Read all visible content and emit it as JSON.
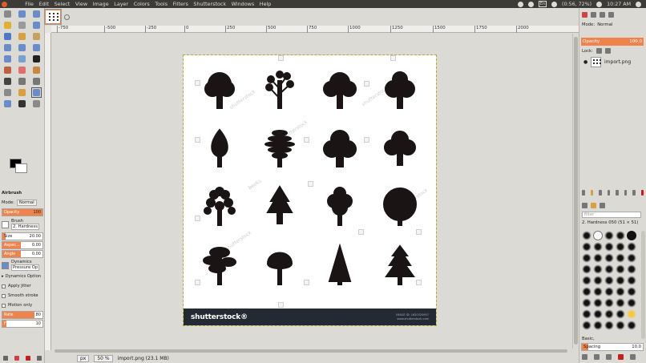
{
  "menubar": {
    "items": [
      "File",
      "Edit",
      "Select",
      "View",
      "Image",
      "Layer",
      "Colors",
      "Tools",
      "Filters",
      "Shutterstock",
      "Windows",
      "Help"
    ],
    "tray": {
      "keyboard": "En",
      "battery": "(0:56, 72%)",
      "clock": "10:27 AM"
    }
  },
  "toolbox": {
    "fg_color": "#000000",
    "bg_color": "#ffffff",
    "tool_options": {
      "title": "Airbrush",
      "mode_label": "Mode:",
      "mode_value": "Normal",
      "opacity_label": "Opacity",
      "opacity_value": "100",
      "brush_label": "Brush",
      "brush_value": "2. Hardness",
      "size_label": "Size",
      "size_value": "20.00",
      "aspect_label": "Aspec...",
      "aspect_value": "0.00",
      "angle_label": "Angle",
      "angle_value": "0.00",
      "dynamics_label": "Dynamics",
      "dynamics_value": "Pressure Op",
      "dynamics_options": "Dynamics Option",
      "apply_jitter": "Apply Jitter",
      "smooth_stroke": "Smooth stroke",
      "motion_only": "Motion only",
      "rate_label": "Rate",
      "rate_value": "80",
      "flow_label": "Flow",
      "flow_value": "10"
    }
  },
  "canvas": {
    "ruler_top": [
      "-750",
      "-500",
      "-250",
      "0",
      "250",
      "500",
      "750",
      "1000",
      "1250",
      "1500",
      "1750",
      "2000"
    ],
    "image": {
      "wm_logo": "shutterstock®",
      "wm_id_line1": "IMAGE ID: 1620320957",
      "wm_id_line2": "www.shutterstock.com",
      "watermarks": [
        "shutterstock",
        "shutterstock",
        "shutterstock",
        "Beeks",
        "Beeks",
        "shutterstock",
        "shutterstock"
      ]
    },
    "status": {
      "unit": "px",
      "zoom": "50 %",
      "info": "import.png (23.1 MB)"
    }
  },
  "docks": {
    "mode_label": "Mode:",
    "mode_value": "Normal",
    "opacity_label": "Opacity",
    "opacity_value": "100.0",
    "lock_label": "Lock:",
    "layer_name": "import.png",
    "brush_filter_placeholder": "filter",
    "brush_name": "2. Hardness 050 (51 × 51)",
    "brush_preset": "Basic,",
    "spacing_label": "Spacing",
    "spacing_value": "10.0"
  }
}
